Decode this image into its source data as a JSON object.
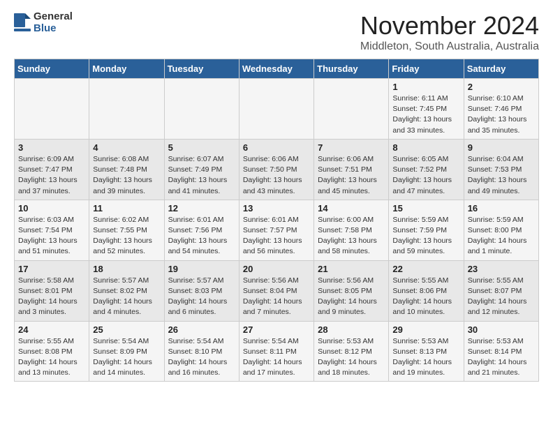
{
  "header": {
    "logo_general": "General",
    "logo_blue": "Blue",
    "month_title": "November 2024",
    "location": "Middleton, South Australia, Australia"
  },
  "days_of_week": [
    "Sunday",
    "Monday",
    "Tuesday",
    "Wednesday",
    "Thursday",
    "Friday",
    "Saturday"
  ],
  "weeks": [
    [
      {
        "day": "",
        "info": ""
      },
      {
        "day": "",
        "info": ""
      },
      {
        "day": "",
        "info": ""
      },
      {
        "day": "",
        "info": ""
      },
      {
        "day": "",
        "info": ""
      },
      {
        "day": "1",
        "info": "Sunrise: 6:11 AM\nSunset: 7:45 PM\nDaylight: 13 hours\nand 33 minutes."
      },
      {
        "day": "2",
        "info": "Sunrise: 6:10 AM\nSunset: 7:46 PM\nDaylight: 13 hours\nand 35 minutes."
      }
    ],
    [
      {
        "day": "3",
        "info": "Sunrise: 6:09 AM\nSunset: 7:47 PM\nDaylight: 13 hours\nand 37 minutes."
      },
      {
        "day": "4",
        "info": "Sunrise: 6:08 AM\nSunset: 7:48 PM\nDaylight: 13 hours\nand 39 minutes."
      },
      {
        "day": "5",
        "info": "Sunrise: 6:07 AM\nSunset: 7:49 PM\nDaylight: 13 hours\nand 41 minutes."
      },
      {
        "day": "6",
        "info": "Sunrise: 6:06 AM\nSunset: 7:50 PM\nDaylight: 13 hours\nand 43 minutes."
      },
      {
        "day": "7",
        "info": "Sunrise: 6:06 AM\nSunset: 7:51 PM\nDaylight: 13 hours\nand 45 minutes."
      },
      {
        "day": "8",
        "info": "Sunrise: 6:05 AM\nSunset: 7:52 PM\nDaylight: 13 hours\nand 47 minutes."
      },
      {
        "day": "9",
        "info": "Sunrise: 6:04 AM\nSunset: 7:53 PM\nDaylight: 13 hours\nand 49 minutes."
      }
    ],
    [
      {
        "day": "10",
        "info": "Sunrise: 6:03 AM\nSunset: 7:54 PM\nDaylight: 13 hours\nand 51 minutes."
      },
      {
        "day": "11",
        "info": "Sunrise: 6:02 AM\nSunset: 7:55 PM\nDaylight: 13 hours\nand 52 minutes."
      },
      {
        "day": "12",
        "info": "Sunrise: 6:01 AM\nSunset: 7:56 PM\nDaylight: 13 hours\nand 54 minutes."
      },
      {
        "day": "13",
        "info": "Sunrise: 6:01 AM\nSunset: 7:57 PM\nDaylight: 13 hours\nand 56 minutes."
      },
      {
        "day": "14",
        "info": "Sunrise: 6:00 AM\nSunset: 7:58 PM\nDaylight: 13 hours\nand 58 minutes."
      },
      {
        "day": "15",
        "info": "Sunrise: 5:59 AM\nSunset: 7:59 PM\nDaylight: 13 hours\nand 59 minutes."
      },
      {
        "day": "16",
        "info": "Sunrise: 5:59 AM\nSunset: 8:00 PM\nDaylight: 14 hours\nand 1 minute."
      }
    ],
    [
      {
        "day": "17",
        "info": "Sunrise: 5:58 AM\nSunset: 8:01 PM\nDaylight: 14 hours\nand 3 minutes."
      },
      {
        "day": "18",
        "info": "Sunrise: 5:57 AM\nSunset: 8:02 PM\nDaylight: 14 hours\nand 4 minutes."
      },
      {
        "day": "19",
        "info": "Sunrise: 5:57 AM\nSunset: 8:03 PM\nDaylight: 14 hours\nand 6 minutes."
      },
      {
        "day": "20",
        "info": "Sunrise: 5:56 AM\nSunset: 8:04 PM\nDaylight: 14 hours\nand 7 minutes."
      },
      {
        "day": "21",
        "info": "Sunrise: 5:56 AM\nSunset: 8:05 PM\nDaylight: 14 hours\nand 9 minutes."
      },
      {
        "day": "22",
        "info": "Sunrise: 5:55 AM\nSunset: 8:06 PM\nDaylight: 14 hours\nand 10 minutes."
      },
      {
        "day": "23",
        "info": "Sunrise: 5:55 AM\nSunset: 8:07 PM\nDaylight: 14 hours\nand 12 minutes."
      }
    ],
    [
      {
        "day": "24",
        "info": "Sunrise: 5:55 AM\nSunset: 8:08 PM\nDaylight: 14 hours\nand 13 minutes."
      },
      {
        "day": "25",
        "info": "Sunrise: 5:54 AM\nSunset: 8:09 PM\nDaylight: 14 hours\nand 14 minutes."
      },
      {
        "day": "26",
        "info": "Sunrise: 5:54 AM\nSunset: 8:10 PM\nDaylight: 14 hours\nand 16 minutes."
      },
      {
        "day": "27",
        "info": "Sunrise: 5:54 AM\nSunset: 8:11 PM\nDaylight: 14 hours\nand 17 minutes."
      },
      {
        "day": "28",
        "info": "Sunrise: 5:53 AM\nSunset: 8:12 PM\nDaylight: 14 hours\nand 18 minutes."
      },
      {
        "day": "29",
        "info": "Sunrise: 5:53 AM\nSunset: 8:13 PM\nDaylight: 14 hours\nand 19 minutes."
      },
      {
        "day": "30",
        "info": "Sunrise: 5:53 AM\nSunset: 8:14 PM\nDaylight: 14 hours\nand 21 minutes."
      }
    ]
  ]
}
